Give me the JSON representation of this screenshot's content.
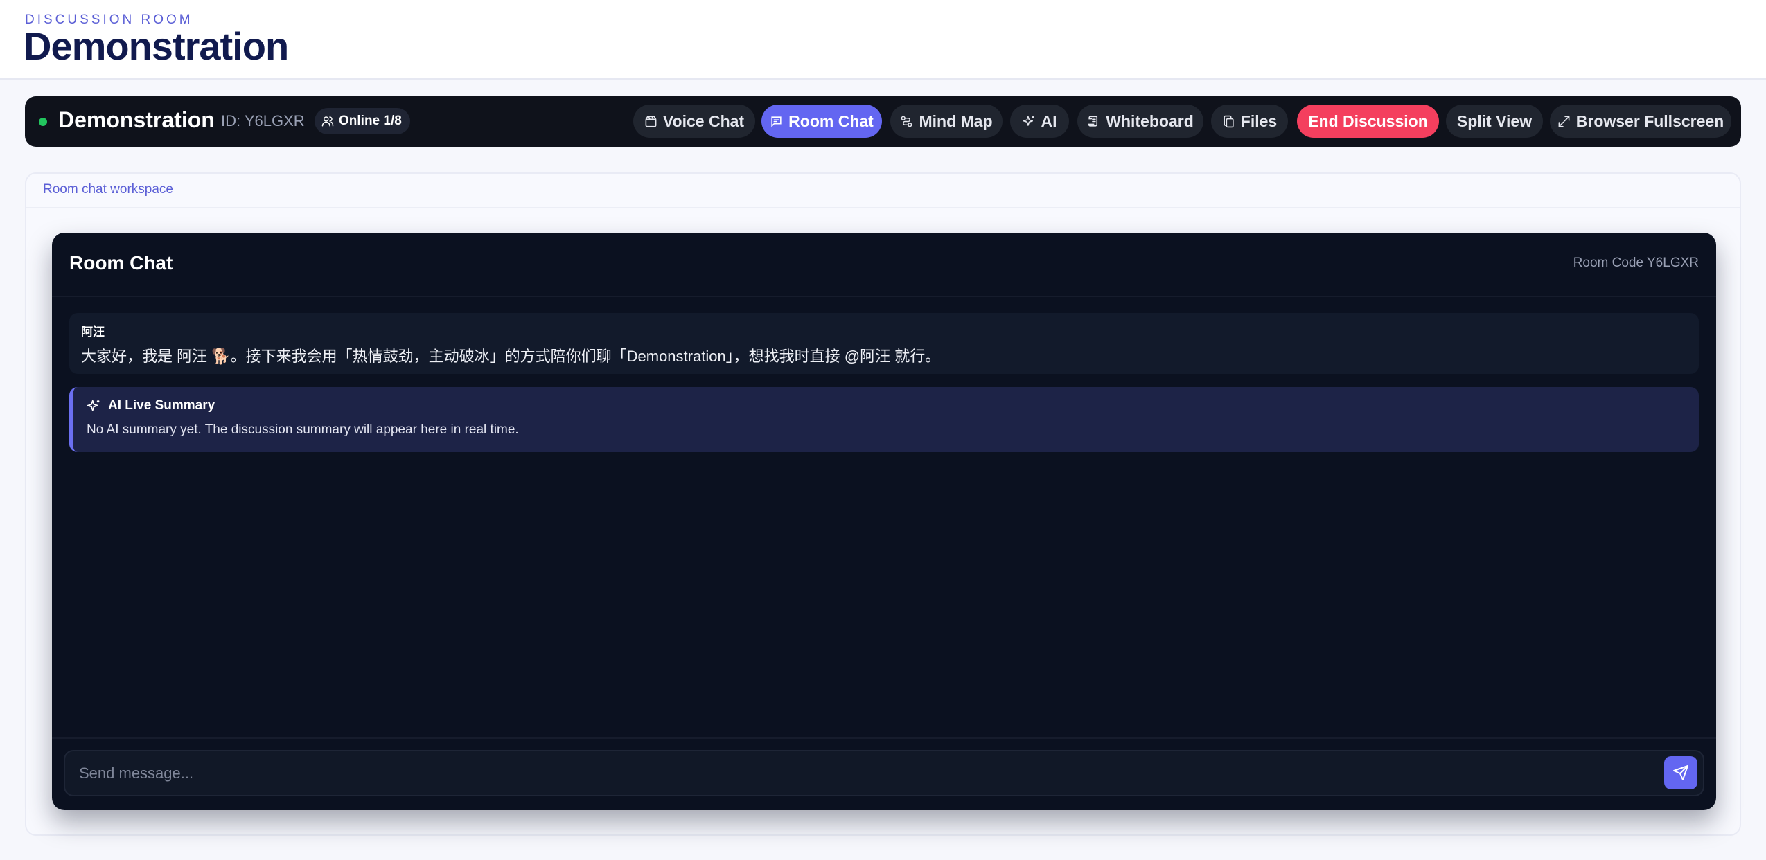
{
  "header": {
    "eyebrow": "DISCUSSION ROOM",
    "title": "Demonstration"
  },
  "toolbar": {
    "room_name": "Demonstration",
    "room_id": "ID: Y6LGXR",
    "online": "Online 1/8",
    "status_color": "#22c55e",
    "buttons": [
      {
        "label": "Voice Chat",
        "icon": "video-icon"
      },
      {
        "label": "Room Chat",
        "icon": "message-icon",
        "active": true
      },
      {
        "label": "Mind Map",
        "icon": "route-icon"
      },
      {
        "label": "AI",
        "icon": "sparkles-icon"
      },
      {
        "label": "Whiteboard",
        "icon": "scroll-icon"
      },
      {
        "label": "Files",
        "icon": "files-icon"
      },
      {
        "label": "End Discussion",
        "danger": true
      },
      {
        "label": "Split View"
      },
      {
        "label": "Browser Fullscreen",
        "icon": "expand-icon"
      }
    ]
  },
  "workspace": {
    "label": "Room chat workspace"
  },
  "chat": {
    "title": "Room Chat",
    "room_code": "Room Code Y6LGXR",
    "messages": [
      {
        "author": "阿汪",
        "text": "大家好，我是 阿汪 🐕。接下来我会用「热情鼓劲，主动破冰」的方式陪你们聊「Demonstration」，想找我时直接 @阿汪 就行。"
      }
    ],
    "summary": {
      "title": "AI Live Summary",
      "text": "No AI summary yet. The discussion summary will appear here in real time."
    },
    "composer": {
      "placeholder": "Send message..."
    }
  },
  "colors": {
    "accent": "#6366f1",
    "danger": "#f43f5e",
    "panel": "#0b1120"
  }
}
